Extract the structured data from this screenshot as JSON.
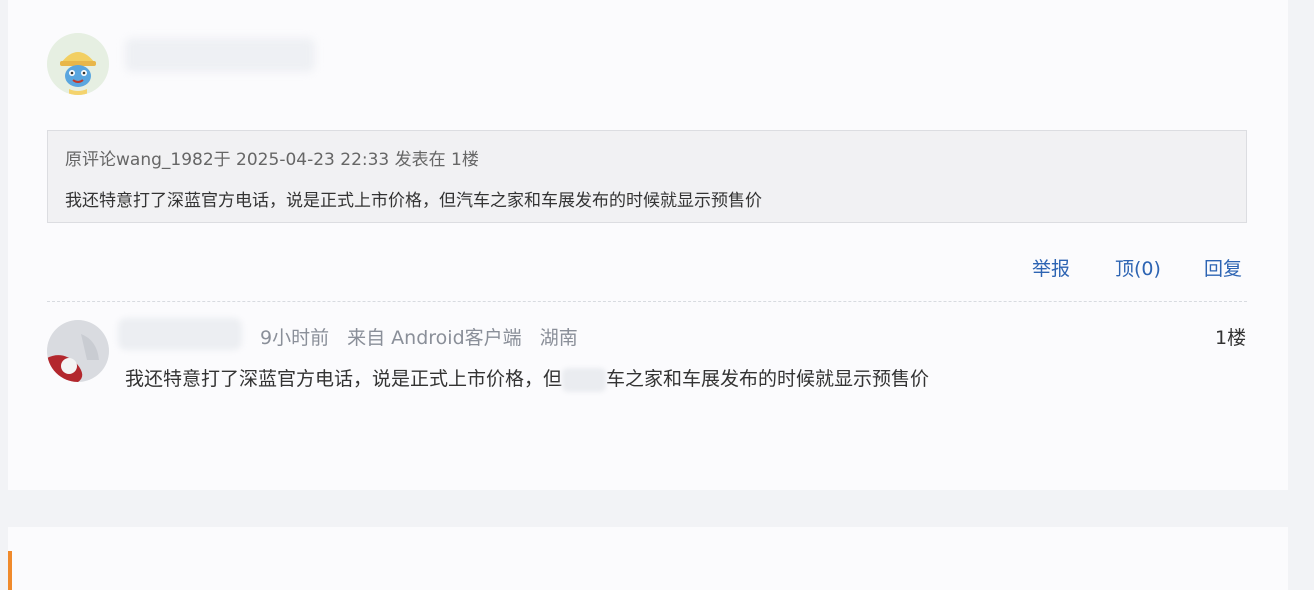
{
  "quote": {
    "meta": "原评论wang_1982于 2025-04-23 22:33 发表在 1楼",
    "text": "我还特意打了深蓝官方电话，说是正式上市价格，但汽车之家和车展发布的时候就显示预售价"
  },
  "actions": {
    "report": "举报",
    "upvote": "顶(0)",
    "reply": "回复"
  },
  "reply": {
    "time": "9小时前",
    "source": "来自 Android客户端",
    "location": "湖南",
    "floor": "1楼",
    "text_before": "我还特意打了深蓝官方电话，说是正式上市价格，但",
    "text_after": "车之家和车展发布的时候就显示预售价"
  },
  "icons": {
    "main_avatar": "user-avatar-icon",
    "reply_avatar": "user-avatar-icon"
  },
  "colors": {
    "link": "#2d64b3",
    "accent": "#f08a2c"
  }
}
